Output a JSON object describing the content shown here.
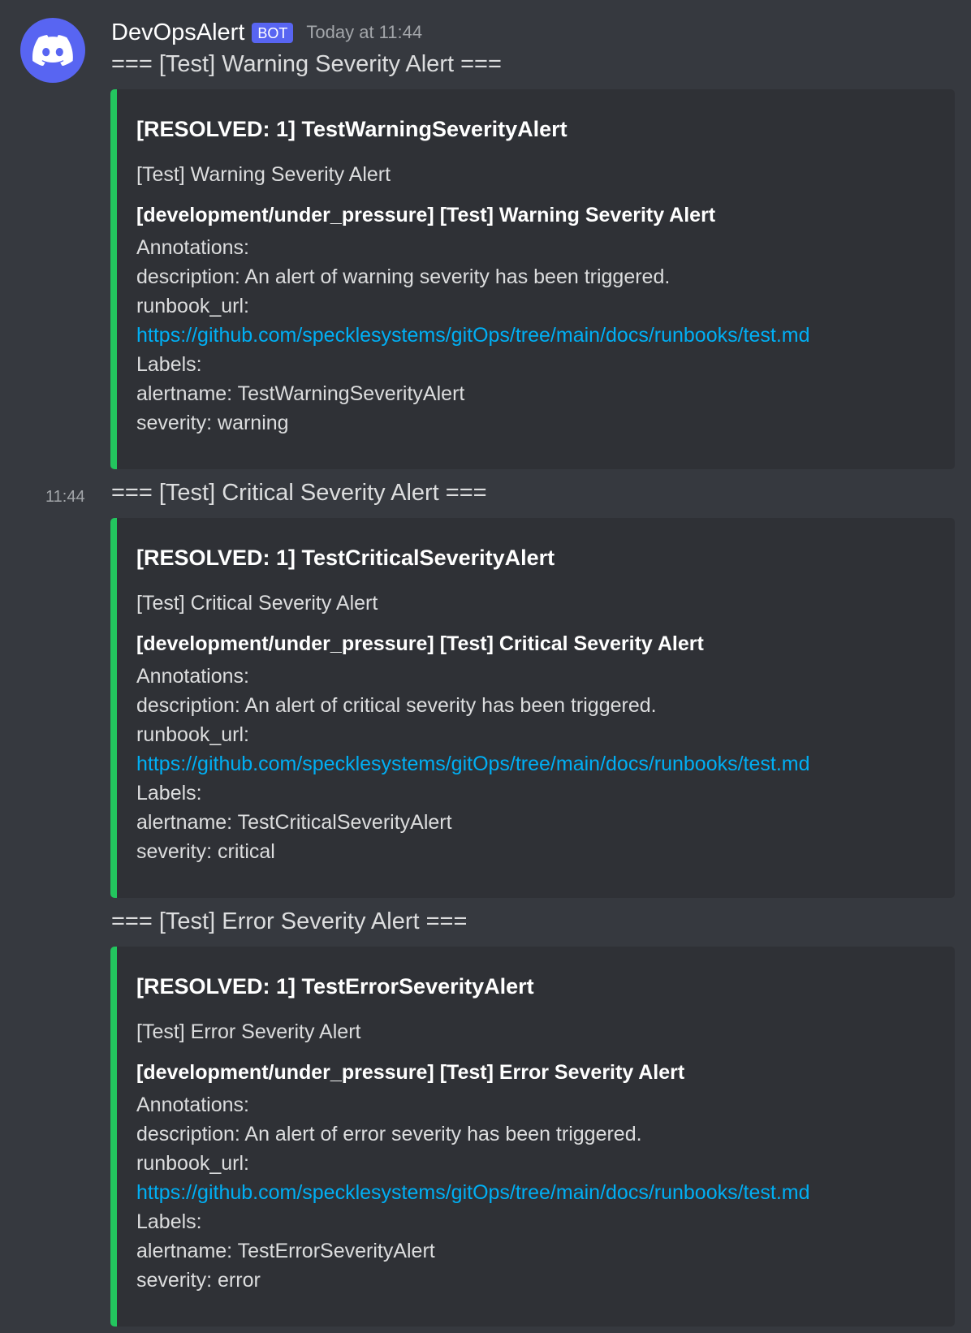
{
  "author": {
    "name": "DevOpsAlert",
    "bot_tag": "BOT",
    "timestamp": "Today at 11:44",
    "avatar_icon": "discord-logo-icon",
    "avatar_color": "#5865f2"
  },
  "accent_color": "#23c55e",
  "link_color": "#00aff4",
  "messages": [
    {
      "side_time": "",
      "text": "=== [Test] Warning Severity Alert ===",
      "embed": {
        "title": "[RESOLVED: 1] TestWarningSeverityAlert",
        "subtitle": "[Test] Warning Severity Alert",
        "heading": "[development/under_pressure] [Test] Warning Severity Alert",
        "annotations_label": "Annotations:",
        "description": "description: An alert of warning severity has been triggered.",
        "runbook_label": "runbook_url:",
        "runbook_url": "https://github.com/specklesystems/gitOps/tree/main/docs/runbooks/test.md",
        "labels_label": "Labels:",
        "alertname": "alertname: TestWarningSeverityAlert",
        "severity": "severity: warning"
      }
    },
    {
      "side_time": "11:44",
      "text": "=== [Test] Critical Severity Alert ===",
      "embed": {
        "title": "[RESOLVED: 1] TestCriticalSeverityAlert",
        "subtitle": "[Test] Critical Severity Alert",
        "heading": "[development/under_pressure] [Test] Critical Severity Alert",
        "annotations_label": "Annotations:",
        "description": "description: An alert of critical severity has been triggered.",
        "runbook_label": "runbook_url:",
        "runbook_url": "https://github.com/specklesystems/gitOps/tree/main/docs/runbooks/test.md",
        "labels_label": "Labels:",
        "alertname": "alertname: TestCriticalSeverityAlert",
        "severity": "severity: critical"
      }
    },
    {
      "side_time": "",
      "text": "=== [Test] Error Severity Alert ===",
      "embed": {
        "title": "[RESOLVED: 1] TestErrorSeverityAlert",
        "subtitle": "[Test] Error Severity Alert",
        "heading": "[development/under_pressure] [Test] Error Severity Alert",
        "annotations_label": "Annotations:",
        "description": "description: An alert of error severity has been triggered.",
        "runbook_label": "runbook_url:",
        "runbook_url": "https://github.com/specklesystems/gitOps/tree/main/docs/runbooks/test.md",
        "labels_label": "Labels:",
        "alertname": "alertname: TestErrorSeverityAlert",
        "severity": "severity: error"
      }
    }
  ]
}
